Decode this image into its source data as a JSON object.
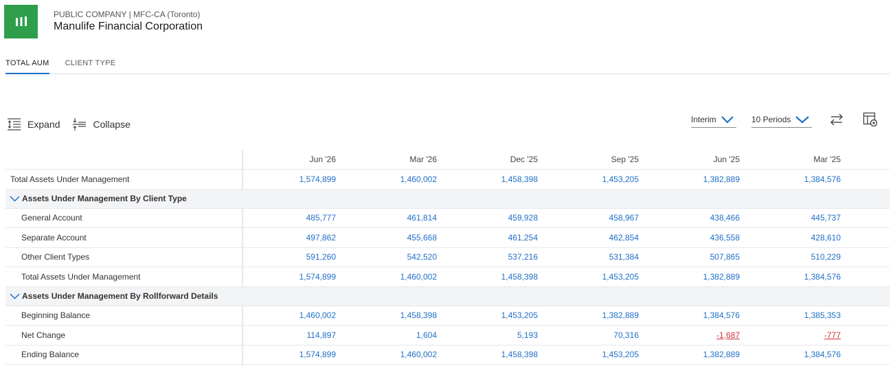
{
  "header": {
    "subtitle": "PUBLIC COMPANY | MFC-CA (Toronto)",
    "company": "Manulife Financial Corporation",
    "logo_icon": "manulife-logo-icon",
    "logo_color": "#2e9e4d"
  },
  "tabs": [
    {
      "label": "TOTAL AUM",
      "active": true
    },
    {
      "label": "CLIENT TYPE",
      "active": false
    }
  ],
  "toolbar": {
    "expand_label": "Expand",
    "collapse_label": "Collapse",
    "frequency": "Interim",
    "periods": "10 Periods"
  },
  "accent_color": "#1f6fc7",
  "negative_color": "#d0303a",
  "table": {
    "columns": [
      "Jun '26",
      "Mar '26",
      "Dec '25",
      "Sep '25",
      "Jun '25",
      "Mar '25"
    ],
    "rows": [
      {
        "kind": "data",
        "label": "Total Assets Under Management",
        "values": [
          "1,574,899",
          "1,460,002",
          "1,458,398",
          "1,453,205",
          "1,382,889",
          "1,384,576"
        ]
      },
      {
        "kind": "section",
        "label": "Assets Under Management By Client Type"
      },
      {
        "kind": "indent",
        "label": "General Account",
        "values": [
          "485,777",
          "461,814",
          "459,928",
          "458,967",
          "438,466",
          "445,737"
        ]
      },
      {
        "kind": "indent",
        "label": "Separate Account",
        "values": [
          "497,862",
          "455,668",
          "461,254",
          "462,854",
          "436,558",
          "428,610"
        ]
      },
      {
        "kind": "indent",
        "label": "Other Client Types",
        "values": [
          "591,260",
          "542,520",
          "537,216",
          "531,384",
          "507,865",
          "510,229"
        ]
      },
      {
        "kind": "indent",
        "label": "Total Assets Under Management",
        "values": [
          "1,574,899",
          "1,460,002",
          "1,458,398",
          "1,453,205",
          "1,382,889",
          "1,384,576"
        ]
      },
      {
        "kind": "section",
        "label": "Assets Under Management By Rollforward Details"
      },
      {
        "kind": "indent",
        "label": "Beginning Balance",
        "values": [
          "1,460,002",
          "1,458,398",
          "1,453,205",
          "1,382,889",
          "1,384,576",
          "1,385,353"
        ]
      },
      {
        "kind": "indent",
        "label": "Net Change",
        "values": [
          "114,897",
          "1,604",
          "5,193",
          "70,316",
          "-1,687",
          "-777"
        ]
      },
      {
        "kind": "indent",
        "label": "Ending Balance",
        "values": [
          "1,574,899",
          "1,460,002",
          "1,458,398",
          "1,453,205",
          "1,382,889",
          "1,384,576"
        ]
      }
    ]
  }
}
